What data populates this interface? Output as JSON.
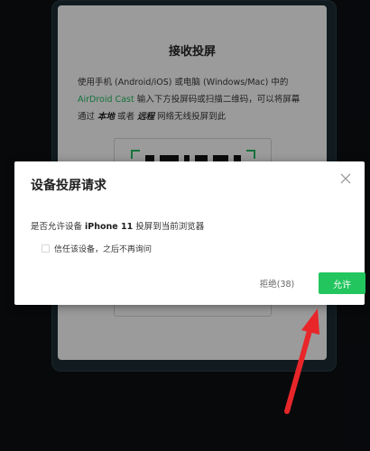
{
  "background_card": {
    "title": "接收投屏",
    "desc_line1": "使用手机 (Android/iOS) 或电脑 (Windows/Mac) 中的",
    "desc_brand": "AirDroid Cast",
    "desc_line2_rest": " 输入下方投屏码或扫描二维码，可以将屏幕",
    "desc_line3_a": "通过 ",
    "desc_local": "本地",
    "desc_line3_b": " 或者 ",
    "desc_remote": "远程",
    "desc_line3_c": " 网络无线投屏到此"
  },
  "modal": {
    "title": "设备投屏请求",
    "question_prefix": "是否允许设备 ",
    "device_name": "iPhone 11",
    "question_suffix": " 投屏到当前浏览器",
    "trust_label": "信任该设备，之后不再询问",
    "reject_label": "拒绝(38)",
    "allow_label": "允许"
  },
  "colors": {
    "accent_green": "#22c55e",
    "annotation_red": "#e8262a"
  },
  "icons": {
    "close": "close-icon",
    "arrow": "red-arrow-annotation"
  }
}
